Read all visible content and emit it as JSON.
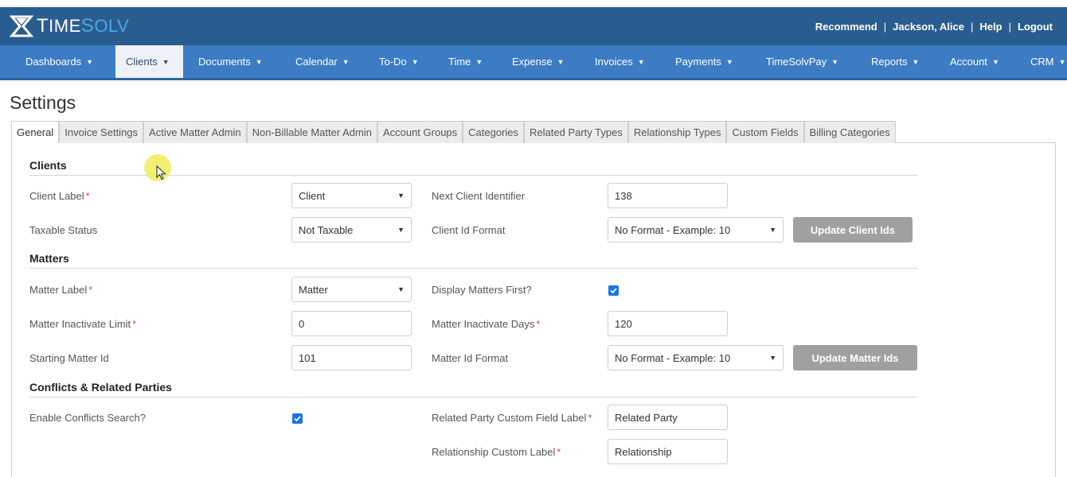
{
  "header": {
    "logo_text_big": "T",
    "logo_text_rest": "IME",
    "logo_text_solv": "S",
    "logo_text_solv_rest": "OLV",
    "links": [
      "Recommend",
      "Jackson, Alice",
      "Help",
      "Logout"
    ]
  },
  "nav": {
    "items": [
      "Dashboards",
      "Clients",
      "Documents",
      "Calendar",
      "To-Do",
      "Time",
      "Expense",
      "Invoices",
      "Payments",
      "TimeSolvPay",
      "Reports",
      "Account",
      "CRM"
    ],
    "active": "Clients"
  },
  "page": {
    "title": "Settings"
  },
  "tabs": [
    "General",
    "Invoice Settings",
    "Active Matter Admin",
    "Non-Billable Matter Admin",
    "Account Groups",
    "Categories",
    "Related Party Types",
    "Relationship Types",
    "Custom Fields",
    "Billing Categories"
  ],
  "clients": {
    "heading": "Clients",
    "client_label": {
      "label": "Client Label",
      "value": "Client"
    },
    "taxable_status": {
      "label": "Taxable Status",
      "value": "Not Taxable"
    },
    "next_client_identifier": {
      "label": "Next Client Identifier",
      "value": "138"
    },
    "client_id_format": {
      "label": "Client Id Format",
      "value": "No Format - Example: 10"
    },
    "update_button": "Update Client Ids"
  },
  "matters": {
    "heading": "Matters",
    "matter_label": {
      "label": "Matter Label",
      "value": "Matter"
    },
    "matter_inactivate_limit": {
      "label": "Matter Inactivate Limit",
      "value": "0"
    },
    "starting_matter_id": {
      "label": "Starting Matter Id",
      "value": "101"
    },
    "display_matters_first": {
      "label": "Display Matters First?",
      "checked": true
    },
    "matter_inactivate_days": {
      "label": "Matter Inactivate Days",
      "value": "120"
    },
    "matter_id_format": {
      "label": "Matter Id Format",
      "value": "No Format - Example: 10"
    },
    "update_button": "Update Matter Ids"
  },
  "conflicts": {
    "heading": "Conflicts & Related Parties",
    "enable_conflicts_search": {
      "label": "Enable Conflicts Search?",
      "checked": true
    },
    "related_party_custom_field_label": {
      "label": "Related Party Custom Field Label",
      "value": "Related Party"
    },
    "relationship_custom_label": {
      "label": "Relationship Custom Label",
      "value": "Relationship"
    }
  },
  "required_marker": "*",
  "colors": {
    "topbar": "#2a5d8f",
    "navbar": "#3b7cc4",
    "logo_accent": "#4aa8e8",
    "checkbox": "#1a73e8",
    "required": "#d9534f",
    "button_disabled": "#a0a0a0"
  }
}
